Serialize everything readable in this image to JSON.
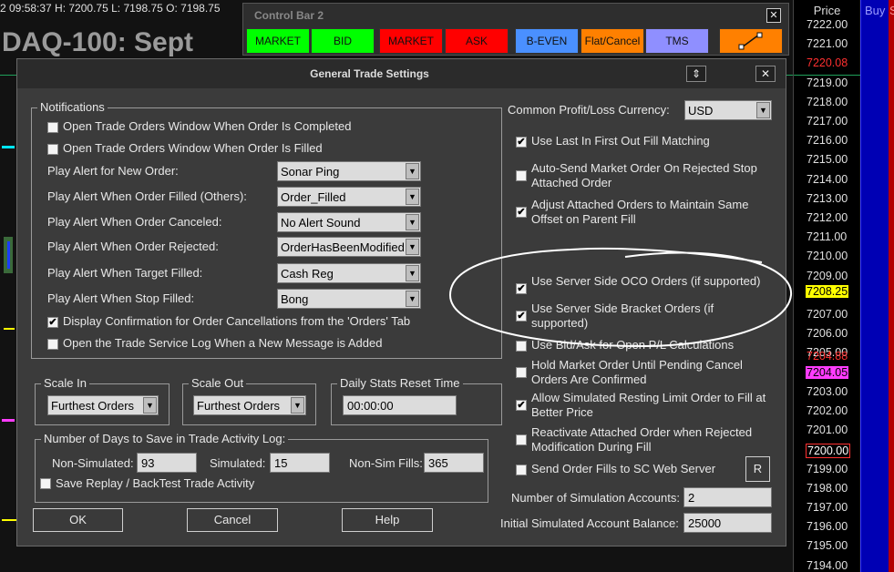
{
  "chart": {
    "top_info": "2 09:58:37 H: 7200.75 L: 7198.75 O: 7198.75",
    "title": "DAQ-100: Sept"
  },
  "price_scale": {
    "header": "Price",
    "ticks": [
      "7222.00",
      "7221.00",
      "7219.00",
      "7218.00",
      "7217.00",
      "7216.00",
      "7215.00",
      "7214.00",
      "7213.00",
      "7212.00",
      "7211.00",
      "7210.00",
      "7209.00",
      "7207.00",
      "7206.00",
      "7205.00",
      "7203.00",
      "7202.00",
      "7201.00",
      "7199.00",
      "7198.00",
      "7197.00",
      "7196.00",
      "7195.00",
      "7194.00"
    ],
    "markers": [
      {
        "value": "7220.08",
        "color": "#ff3030",
        "bg": "transparent",
        "border": "none"
      },
      {
        "value": "7208.25",
        "color": "#000000",
        "bg": "#ffff00",
        "border": "none"
      },
      {
        "value": "7204.88",
        "color": "#ff3030",
        "bg": "transparent",
        "border": "none"
      },
      {
        "value": "7204.05",
        "color": "#000000",
        "bg": "#ff3cff",
        "border": "none"
      },
      {
        "value": "7200.00",
        "color": "#ffffff",
        "bg": "#000000",
        "border": "1px solid #ff3030"
      }
    ],
    "buy_header": "Buy",
    "sell_header": "S"
  },
  "control_bar": {
    "title": "Control Bar 2",
    "close": "✕",
    "buttons": [
      {
        "label": "MARKET",
        "color": "#00ff00"
      },
      {
        "label": "BID",
        "color": "#00ff00"
      },
      {
        "label": "MARKET",
        "color": "#ff0000"
      },
      {
        "label": "ASK",
        "color": "#ff0000"
      },
      {
        "label": "B-EVEN",
        "color": "#4a90ff"
      },
      {
        "label": "Flat/Cancel",
        "color": "#ff8000"
      },
      {
        "label": "TMS",
        "color": "#8f8fff"
      }
    ],
    "tool_button_color": "#ff8000"
  },
  "dialog": {
    "title": "General Trade Settings",
    "updown": "⇕",
    "close": "✕",
    "notifications": {
      "title": "Notifications",
      "checkboxes": [
        {
          "label": "Open Trade Orders Window When Order Is Completed",
          "checked": false
        },
        {
          "label": "Open Trade Orders Window When Order Is Filled",
          "checked": false
        }
      ],
      "alerts": [
        {
          "label": "Play Alert for New Order:",
          "value": "Sonar Ping"
        },
        {
          "label": "Play Alert When Order Filled (Others):",
          "value": "Order_Filled"
        },
        {
          "label": "Play Alert When Order Canceled:",
          "value": "No Alert Sound"
        },
        {
          "label": "Play Alert When Order Rejected:",
          "value": "OrderHasBeenModified"
        },
        {
          "label": "Play Alert When Target Filled:",
          "value": "Cash Reg"
        },
        {
          "label": "Play Alert When Stop Filled:",
          "value": "Bong"
        }
      ],
      "checkboxes2": [
        {
          "label": "Display Confirmation for Order Cancellations from the 'Orders' Tab",
          "checked": true
        },
        {
          "label": "Open the Trade Service Log When a New Message is Added",
          "checked": false
        }
      ]
    },
    "scale_in": {
      "title": "Scale In",
      "value": "Furthest Orders"
    },
    "scale_out": {
      "title": "Scale Out",
      "value": "Furthest Orders"
    },
    "daily_stats": {
      "title": "Daily Stats Reset Time",
      "value": "00:00:00"
    },
    "days_to_save": {
      "title": "Number of Days to Save in Trade Activity Log:",
      "non_sim_label": "Non-Simulated:",
      "non_sim_value": "93",
      "sim_label": "Simulated:",
      "sim_value": "15",
      "nonsim_fills_label": "Non-Sim Fills:",
      "nonsim_fills_value": "365",
      "save_replay_label": "Save Replay / BackTest Trade Activity",
      "save_replay_checked": false
    },
    "buttons": {
      "ok": "OK",
      "cancel": "Cancel",
      "help": "Help"
    },
    "right": {
      "currency_label": "Common Profit/Loss Currency:",
      "currency_value": "USD",
      "options": [
        {
          "label": "Use Last In First Out Fill Matching",
          "checked": true
        },
        {
          "label": "Auto-Send Market Order On Rejected Stop Attached Order",
          "checked": false
        },
        {
          "label": "Adjust Attached Orders to Maintain Same Offset on Parent Fill",
          "checked": true
        },
        {
          "label": "Use Server Side OCO Orders (if supported)",
          "checked": true
        },
        {
          "label": "Use Server Side Bracket Orders (if supported)",
          "checked": true
        },
        {
          "label": "Use Bid/Ask for Open P/L Calculations",
          "checked": false
        },
        {
          "label": "Hold Market Order Until Pending Cancel Orders Are Confirmed",
          "checked": false
        },
        {
          "label": "Allow Simulated Resting Limit Order to Fill at Better Price",
          "checked": true
        },
        {
          "label": "Reactivate Attached Order when Rejected Modification During Fill",
          "checked": false
        },
        {
          "label": "Send Order Fills to SC Web Server",
          "checked": false
        }
      ],
      "r_button": "R",
      "num_sim_label": "Number of Simulation Accounts:",
      "num_sim_value": "2",
      "init_balance_label": "Initial Simulated Account Balance:",
      "init_balance_value": "25000"
    }
  }
}
